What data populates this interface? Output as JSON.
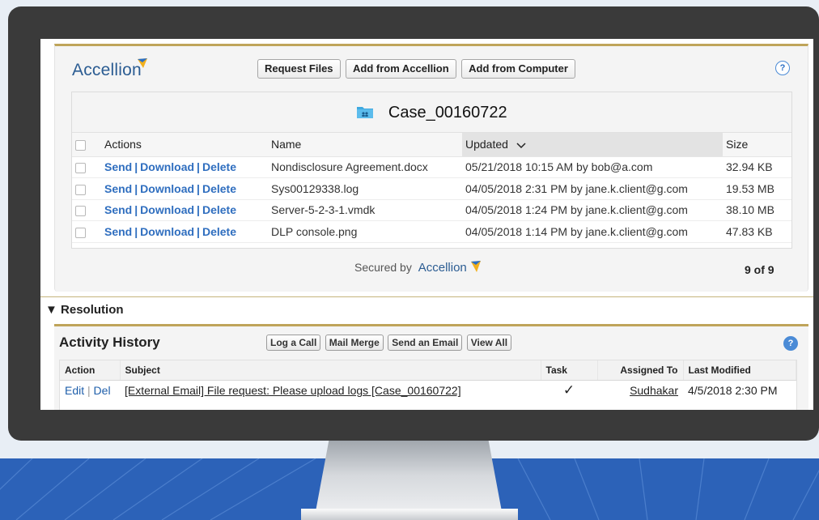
{
  "accellion": {
    "brand": "Accellion",
    "buttons": {
      "request_files": "Request Files",
      "add_from_accellion": "Add from Accellion",
      "add_from_computer": "Add from Computer"
    },
    "help": "?",
    "case_title": "Case_00160722",
    "columns": {
      "actions": "Actions",
      "name": "Name",
      "updated": "Updated",
      "size": "Size"
    },
    "action_labels": {
      "send": "Send",
      "download": "Download",
      "delete": "Delete",
      "sep": "|"
    },
    "files": [
      {
        "name": "Nondisclosure Agreement.docx",
        "updated": "05/21/2018 10:15 AM by bob@a.com",
        "size": "32.94 KB"
      },
      {
        "name": "Sys00129338.log",
        "updated": "04/05/2018 2:31 PM by jane.k.client@g.com",
        "size": "19.53 MB"
      },
      {
        "name": "Server-5-2-3-1.vmdk",
        "updated": "04/05/2018 1:24 PM by jane.k.client@g.com",
        "size": "38.10 MB"
      },
      {
        "name": "DLP console.png",
        "updated": "04/05/2018 1:14 PM by jane.k.client@g.com",
        "size": "47.83 KB"
      }
    ],
    "secured_by": "Secured by",
    "count": "9 of 9"
  },
  "resolution": {
    "label": "Resolution"
  },
  "activity_history": {
    "title": "Activity History",
    "buttons": {
      "log_call": "Log a Call",
      "mail_merge": "Mail Merge",
      "send_email": "Send an Email",
      "view_all": "View All"
    },
    "help": "?",
    "columns": {
      "action": "Action",
      "subject": "Subject",
      "task": "Task",
      "assigned_to": "Assigned To",
      "last_modified": "Last Modified"
    },
    "rows": [
      {
        "edit": "Edit",
        "sep": "|",
        "del": "Del",
        "subject": "[External Email] File request: Please upload logs [Case_00160722]",
        "task": "✓",
        "assigned_to": "Sudhakar",
        "last_modified": "4/5/2018 2:30 PM"
      }
    ]
  },
  "colors": {
    "accent_gold": "#bfa45a",
    "brand_blue": "#2b5c92",
    "link_blue": "#2f6ebf",
    "floor_blue": "#2c62b8",
    "bezel": "#3a3a3a"
  }
}
